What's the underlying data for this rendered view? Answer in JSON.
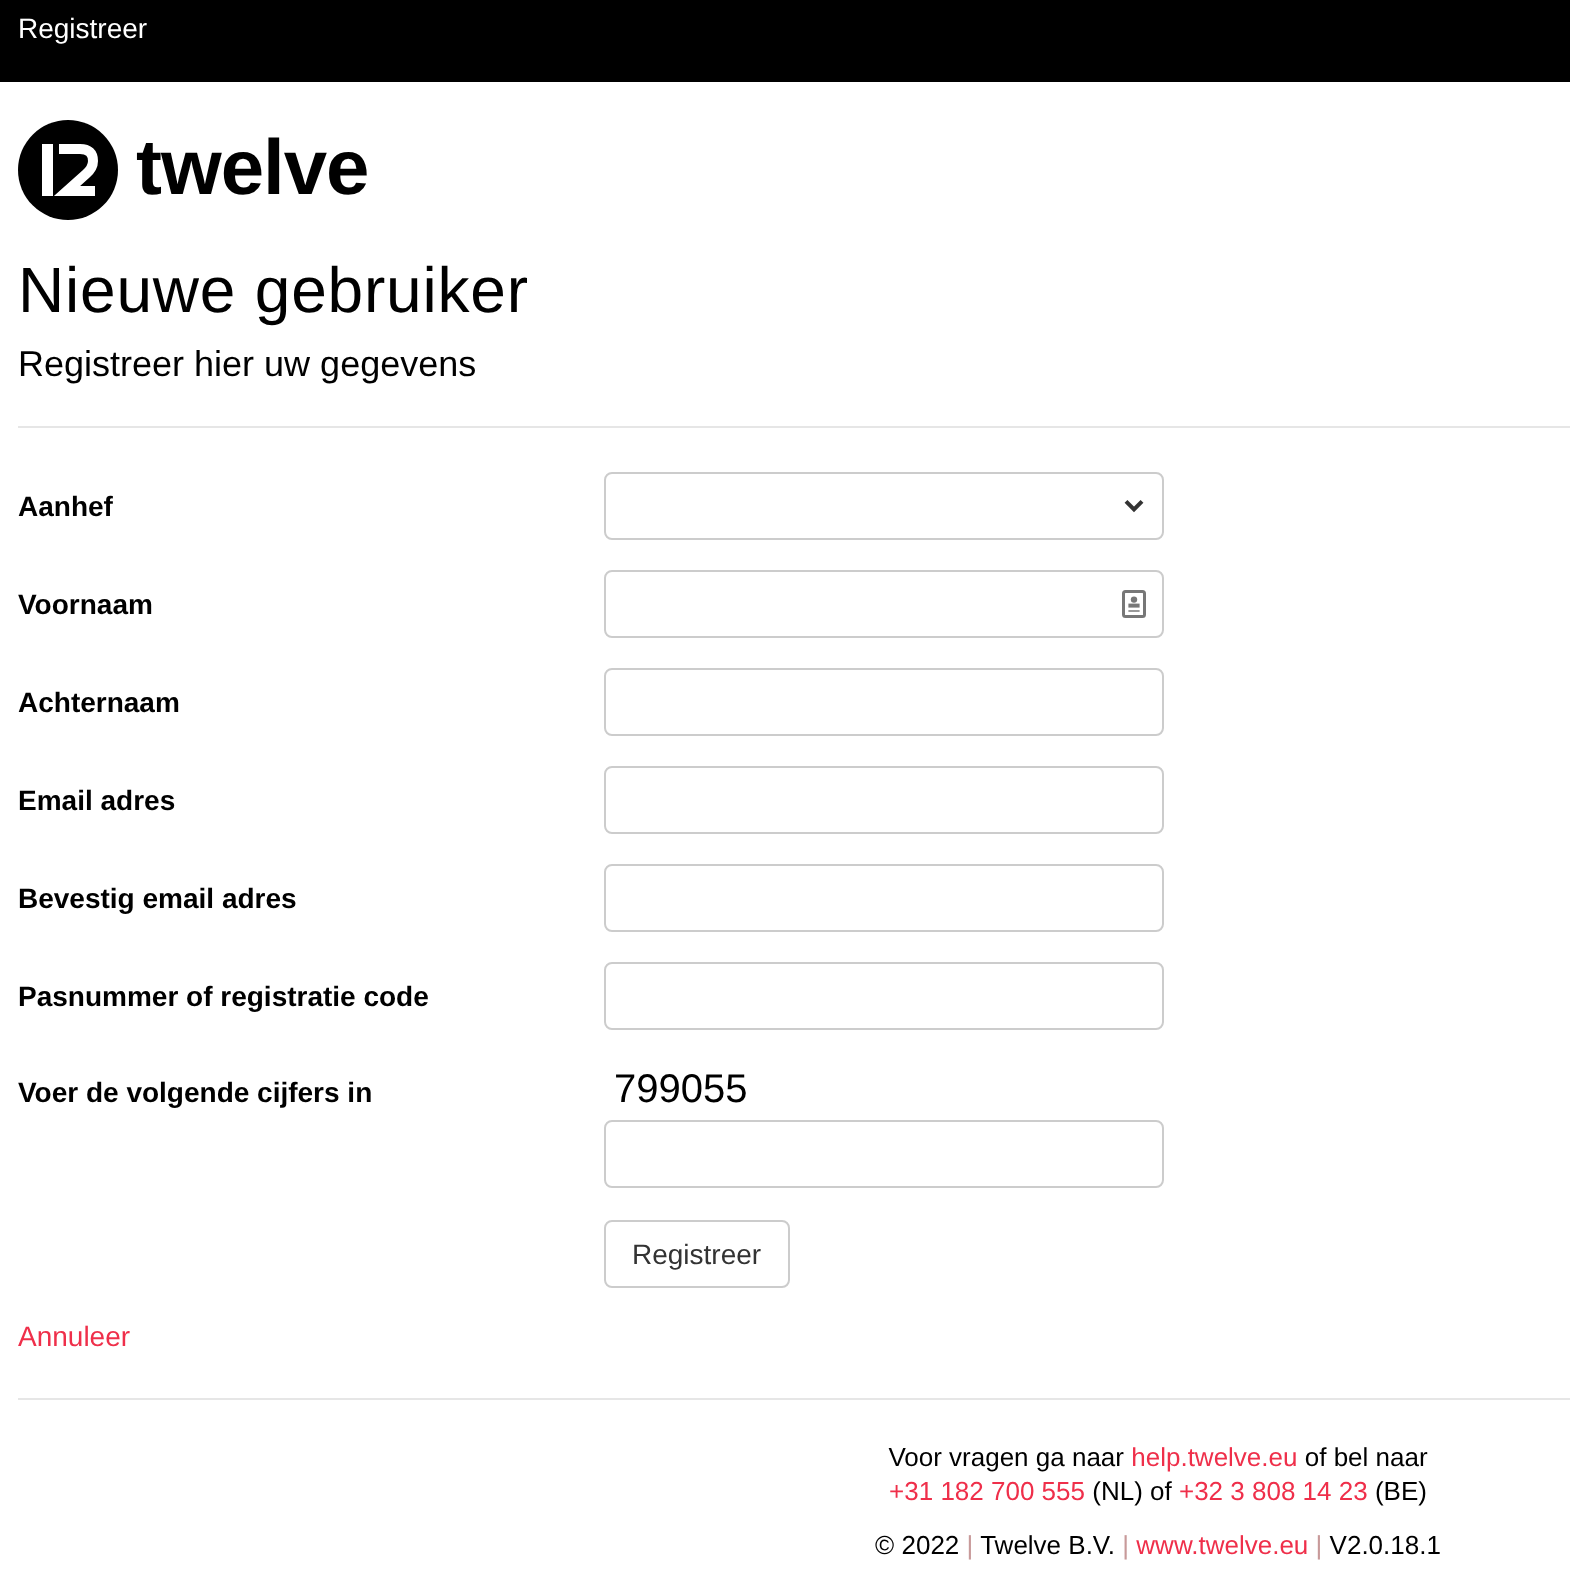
{
  "top_bar": {
    "title": "Registreer"
  },
  "logo": {
    "wordmark": "twelve"
  },
  "heading": "Nieuwe gebruiker",
  "subheading": "Registreer hier uw gegevens",
  "fields": [
    {
      "kind": "select",
      "label": "Aanhef",
      "autofill_icon": false
    },
    {
      "kind": "text",
      "label": "Voornaam",
      "autofill_icon": true
    },
    {
      "kind": "text",
      "label": "Achternaam",
      "autofill_icon": false
    },
    {
      "kind": "text",
      "label": "Email adres",
      "autofill_icon": false
    },
    {
      "kind": "text",
      "label": "Bevestig email adres",
      "autofill_icon": false
    },
    {
      "kind": "text",
      "label": "Pasnummer of registratie code",
      "autofill_icon": false
    },
    {
      "kind": "captcha",
      "label": "Voer de volgende cijfers in",
      "code": "799055",
      "autofill_icon": false
    }
  ],
  "submit_button": "Registreer",
  "cancel_link": "Annuleer",
  "footer": {
    "help_lines": [
      {
        "parts": [
          {
            "kind": "text",
            "text": "Voor vragen ga naar"
          },
          {
            "kind": "link",
            "text": "help.twelve.eu"
          },
          {
            "kind": "text",
            "text": "of bel naar"
          }
        ]
      },
      {
        "parts": [
          {
            "kind": "link",
            "text": "+31 182 700 555"
          },
          {
            "kind": "text",
            "text": "(NL) of"
          },
          {
            "kind": "link",
            "text": "+32 3 808 14 23"
          },
          {
            "kind": "text",
            "text": "(BE)"
          }
        ]
      }
    ],
    "bottom_line": [
      {
        "kind": "text",
        "text": "© 2022"
      },
      {
        "kind": "separator",
        "text": "|"
      },
      {
        "kind": "text",
        "text": "Twelve B.V."
      },
      {
        "kind": "separator",
        "text": "|"
      },
      {
        "kind": "link",
        "text": "www.twelve.eu"
      },
      {
        "kind": "separator",
        "text": "|"
      },
      {
        "kind": "text",
        "text": "V2.0.18.1"
      }
    ]
  }
}
